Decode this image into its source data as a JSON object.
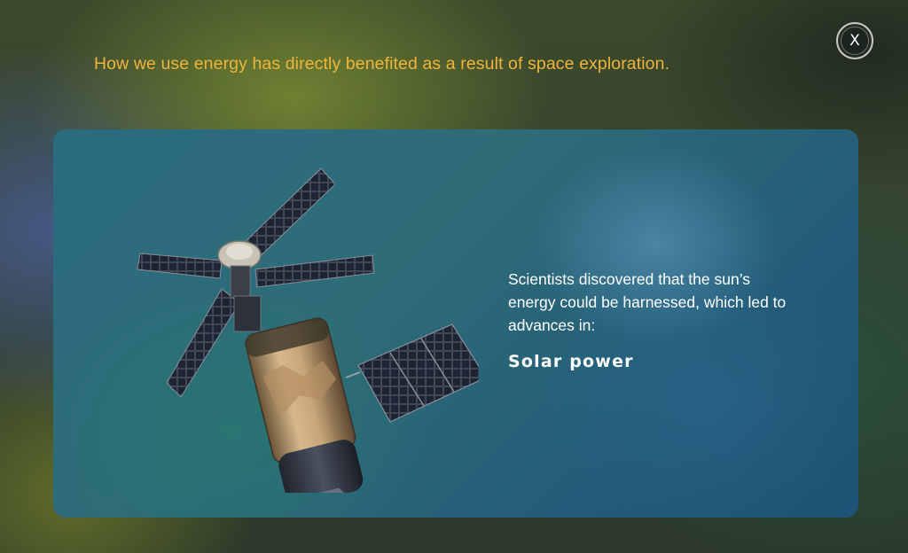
{
  "header": {
    "title": "How we use energy has directly benefited as a result of space exploration."
  },
  "close_button": {
    "label": "X",
    "icon": "close-icon"
  },
  "card": {
    "image": "space-station-satellite",
    "description": "Scientists discovered that the sun’s energy could be harnessed, which led to advances in:",
    "subject": "Solar power"
  },
  "colors": {
    "heading": "#f0b43a",
    "text": "#ffffff",
    "panel": "#2a6b80"
  }
}
